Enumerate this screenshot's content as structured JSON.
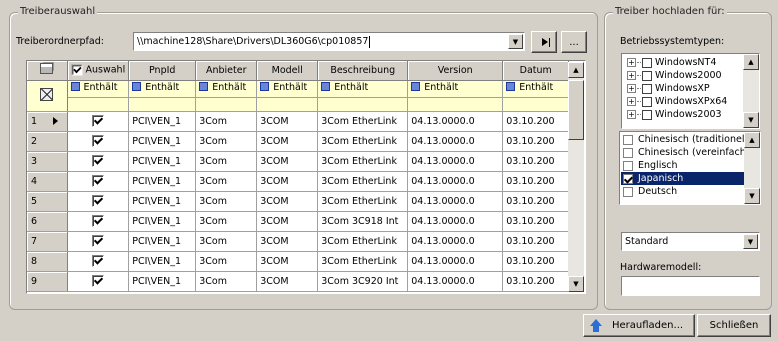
{
  "left_group": {
    "legend": "Treiberauswahl",
    "path_label": "Treiberordnerpfad:",
    "path_value": "\\\\machine128\\Share\\Drivers\\DL360G6\\cp010857",
    "browse_label": "..."
  },
  "grid": {
    "headers": [
      "Auswahl",
      "PnpId",
      "Anbieter",
      "Modell",
      "Beschreibung",
      "Version",
      "Datum"
    ],
    "filter_label": "Enthält",
    "rows": [
      {
        "num": "1",
        "current": true,
        "checked": true,
        "cells": [
          "PCI\\VEN_1",
          "3Com",
          "3COM",
          "3Com EtherLink",
          "04.13.0000.0",
          "03.10.200"
        ]
      },
      {
        "num": "2",
        "current": false,
        "checked": true,
        "cells": [
          "PCI\\VEN_1",
          "3Com",
          "3COM",
          "3Com EtherLink",
          "04.13.0000.0",
          "03.10.200"
        ]
      },
      {
        "num": "3",
        "current": false,
        "checked": true,
        "cells": [
          "PCI\\VEN_1",
          "3Com",
          "3COM",
          "3Com EtherLink",
          "04.13.0000.0",
          "03.10.200"
        ]
      },
      {
        "num": "4",
        "current": false,
        "checked": true,
        "cells": [
          "PCI\\VEN_1",
          "3Com",
          "3COM",
          "3Com EtherLink",
          "04.13.0000.0",
          "03.10.200"
        ]
      },
      {
        "num": "5",
        "current": false,
        "checked": true,
        "cells": [
          "PCI\\VEN_1",
          "3Com",
          "3COM",
          "3Com EtherLink",
          "04.13.0000.0",
          "03.10.200"
        ]
      },
      {
        "num": "6",
        "current": false,
        "checked": true,
        "cells": [
          "PCI\\VEN_1",
          "3Com",
          "3COM",
          "3Com 3C918 Int",
          "04.13.0000.0",
          "03.10.200"
        ]
      },
      {
        "num": "7",
        "current": false,
        "checked": true,
        "cells": [
          "PCI\\VEN_1",
          "3Com",
          "3COM",
          "3Com EtherLink",
          "04.13.0000.0",
          "03.10.200"
        ]
      },
      {
        "num": "8",
        "current": false,
        "checked": true,
        "cells": [
          "PCI\\VEN_1",
          "3Com",
          "3COM",
          "3Com EtherLink",
          "04.13.0000.0",
          "03.10.200"
        ]
      },
      {
        "num": "9",
        "current": false,
        "checked": true,
        "cells": [
          "PCI\\VEN_1",
          "3Com",
          "3COM",
          "3Com 3C920 Int",
          "04.13.0000.0",
          "03.10.200"
        ]
      }
    ]
  },
  "right_group": {
    "legend": "Treiber hochladen für:",
    "os_label": "Betriebssystemtypen:",
    "os_items": [
      {
        "label": "WindowsNT4",
        "checked": false
      },
      {
        "label": "Windows2000",
        "checked": false
      },
      {
        "label": "WindowsXP",
        "checked": false
      },
      {
        "label": "WindowsXPx64",
        "checked": false
      },
      {
        "label": "Windows2003",
        "checked": false
      }
    ],
    "languages": [
      {
        "label": "Chinesisch (traditionell)",
        "checked": false,
        "selected": false
      },
      {
        "label": "Chinesisch (vereinfacht)",
        "checked": false,
        "selected": false
      },
      {
        "label": "Englisch",
        "checked": false,
        "selected": false
      },
      {
        "label": "Japanisch",
        "checked": true,
        "selected": true
      },
      {
        "label": "Deutsch",
        "checked": false,
        "selected": false
      }
    ],
    "type_select": "Standard",
    "hw_label": "Hardwaremodell:",
    "hw_value": ""
  },
  "footer": {
    "upload_label": "Heraufladen...",
    "close_label": "Schließen"
  },
  "colors": {
    "selection": "#0a246a",
    "filter_row": "#ffffd0",
    "upload_icon": "#2a6fd6"
  }
}
